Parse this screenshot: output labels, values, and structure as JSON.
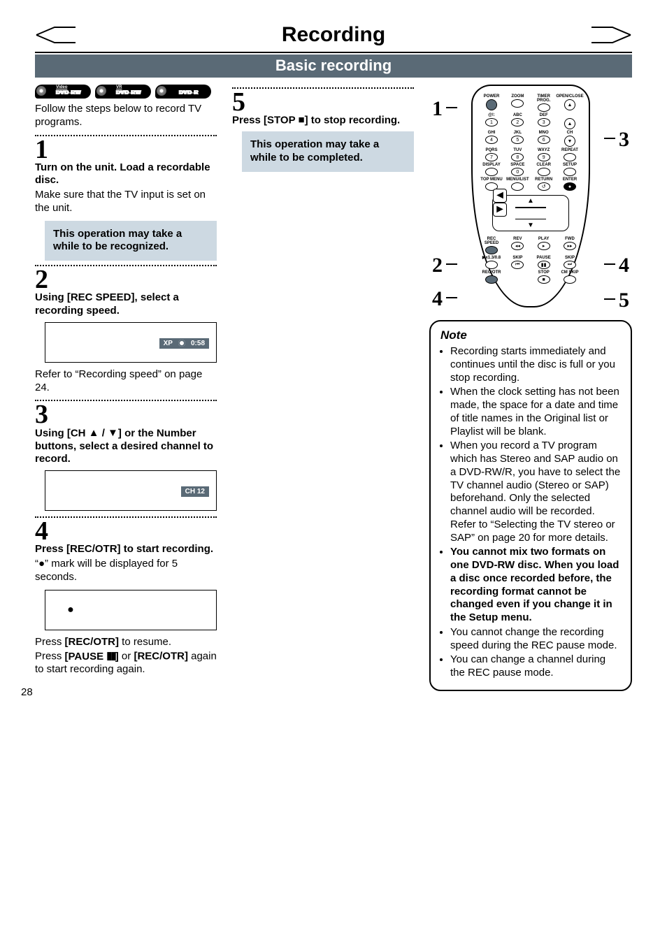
{
  "header": {
    "title": "Recording",
    "subtitle": "Basic recording"
  },
  "disc_badges": [
    {
      "top": "Video",
      "main": "DVD-RW"
    },
    {
      "top": "VR",
      "main": "DVD-RW"
    },
    {
      "top": "",
      "main": "DVD-R"
    }
  ],
  "intro": "Follow the steps below to record TV programs.",
  "steps": {
    "s1": {
      "num": "1",
      "title": "Turn on the unit. Load a recordable disc.",
      "body": "Make sure that the TV input is set on the unit.",
      "callout": "This operation may take a while to be recognized."
    },
    "s2": {
      "num": "2",
      "title": "Using [REC SPEED], select a recording speed.",
      "chip_left": "XP",
      "chip_right": "0:58",
      "after": "Refer to “Recording speed” on page 24."
    },
    "s3": {
      "num": "3",
      "title_a": "Using [CH ",
      "title_b": " / ",
      "title_c": "] or the Number buttons, select a desired channel to record.",
      "chip": "CH   12"
    },
    "s4": {
      "num": "4",
      "title": "Press [REC/OTR] to start recording.",
      "body": "“●” mark will be displayed for 5 seconds.",
      "mark": "●",
      "resume1a": "Press ",
      "resume1b": "[REC/OTR]",
      "resume1c": " to resume.",
      "resume2a": "Press ",
      "resume2b": "[PAUSE ",
      "resume2c": "]",
      "resume2d": " or ",
      "resume2e": "[REC/OTR]",
      "resume2f": " again to start recording again."
    },
    "s5": {
      "num": "5",
      "title_a": "Press [STOP ",
      "title_b": "] to stop recording.",
      "callout": "This operation may take a while to be completed."
    }
  },
  "remote": {
    "callouts": {
      "c1": "1",
      "c2": "2",
      "c3": "3",
      "c4": "4",
      "c5": "5"
    },
    "row1": {
      "power": "POWER",
      "zoom": "ZOOM",
      "timer": "TIMER PROG.",
      "open": "OPEN/CLOSE"
    },
    "keypad": {
      "r1": [
        {
          "t": "@!:",
          "n": "1"
        },
        {
          "t": "ABC",
          "n": "2"
        },
        {
          "t": "DEF",
          "n": "3"
        }
      ],
      "r2": [
        {
          "t": "GHI",
          "n": "4"
        },
        {
          "t": "JKL",
          "n": "5"
        },
        {
          "t": "MNO",
          "n": "6"
        }
      ],
      "r3": [
        {
          "t": "PQRS",
          "n": "7"
        },
        {
          "t": "TUV",
          "n": "8"
        },
        {
          "t": "WXYZ",
          "n": "9"
        }
      ],
      "ch": "CH",
      "repeat": "REPEAT"
    },
    "row_disp": {
      "display": "DISPLAY",
      "space": "SPACE",
      "zero": "0",
      "clear": "CLEAR",
      "setup": "SETUP"
    },
    "row_menu": {
      "topmenu": "TOP MENU",
      "menulist": "MENU/LIST",
      "return": "RETURN",
      "enter": "ENTER"
    },
    "transport1": {
      "recspeed": "REC SPEED",
      "rev": "REV",
      "play": "PLAY",
      "fwd": "FWD"
    },
    "transport2": {
      "x13": "▶x1.3/0.8",
      "skip": "SKIP",
      "pause": "PAUSE",
      "skip2": "SKIP"
    },
    "transport3": {
      "recotr": "REC/OTR",
      "stop": "STOP",
      "cmskip": "CM SKIP"
    }
  },
  "note": {
    "heading": "Note",
    "items": [
      {
        "text": "Recording starts immediately and continues until the disc is full or you stop recording.",
        "bold": false
      },
      {
        "text": "When the clock setting has not been made, the space for a date and time of title names in the Original list or Playlist will be blank.",
        "bold": false
      },
      {
        "text": "When you record a TV program which has Stereo and SAP audio on a DVD-RW/R, you have to select the TV channel audio (Stereo or SAP) beforehand. Only the selected channel audio will be recorded. Refer to “Selecting the TV stereo or SAP” on page 20 for more details.",
        "bold": false
      },
      {
        "text": "You cannot mix two formats on one DVD-RW disc. When you load a disc once recorded before, the recording format cannot be changed even if you change it in the Setup menu.",
        "bold": true
      },
      {
        "text": "You cannot change the recording speed during the REC pause mode.",
        "bold": false
      },
      {
        "text": "You can change a channel during the REC pause mode.",
        "bold": false
      }
    ]
  },
  "page_number": "28",
  "chart_data": null
}
